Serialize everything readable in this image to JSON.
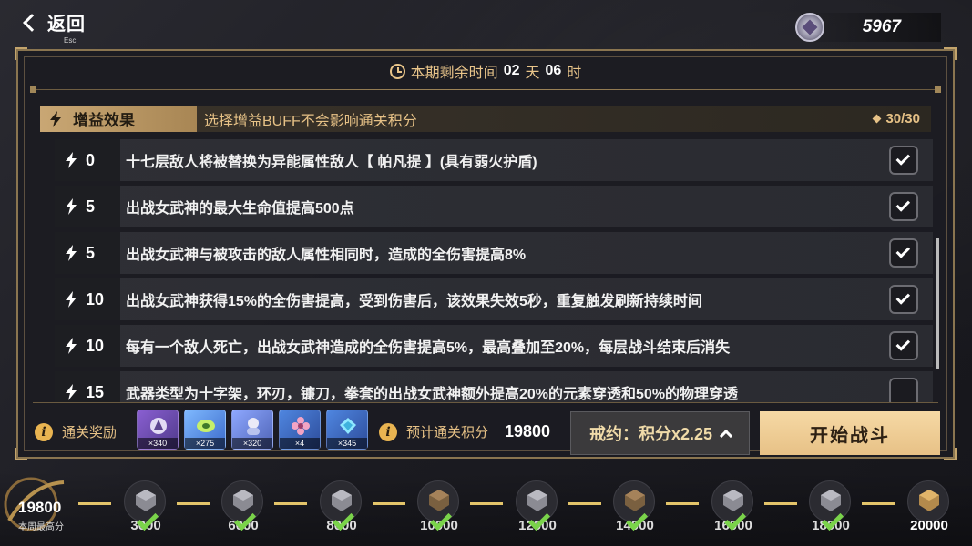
{
  "topbar": {
    "back_label": "返回",
    "esc_hint": "Esc",
    "currency_value": "5967"
  },
  "timer": {
    "prefix": "本期剩余时间",
    "days": "02",
    "days_unit": "天",
    "hours": "06",
    "hours_unit": "时"
  },
  "buff_header": {
    "tab_label": "增益效果",
    "note": "选择增益BUFF不会影响通关积分",
    "count": "30/30"
  },
  "buffs": [
    {
      "cost": "0",
      "text": "十七层敌人将被替换为异能属性敌人【 帕凡提 】(具有弱火护盾)",
      "checked": true
    },
    {
      "cost": "5",
      "text": "出战女武神的最大生命值提高500点",
      "checked": true
    },
    {
      "cost": "5",
      "text": "出战女武神与被攻击的敌人属性相同时，造成的全伤害提高8%",
      "checked": true
    },
    {
      "cost": "10",
      "text": "出战女武神获得15%的全伤害提高，受到伤害后，该效果失效5秒，重复触发刷新持续时间",
      "checked": true
    },
    {
      "cost": "10",
      "text": "每有一个敌人死亡，出战女武神造成的全伤害提高5%，最高叠加至20%，每层战斗结束后消失",
      "checked": true
    },
    {
      "cost": "15",
      "text": "武器类型为十字架，环刃，镰刀，拳套的出战女武神额外提高20%的元素穿透和50%的物理穿透",
      "checked": false
    }
  ],
  "rewards": {
    "label": "通关奖励",
    "items": [
      {
        "icon": "valkyrie-crest-icon",
        "qty": "×340"
      },
      {
        "icon": "green-disc-icon",
        "qty": "×275"
      },
      {
        "icon": "valkyrie-portrait-icon",
        "qty": "×320"
      },
      {
        "icon": "pink-flower-icon",
        "qty": "×4"
      },
      {
        "icon": "blue-crystal-icon",
        "qty": "×345"
      }
    ]
  },
  "predict": {
    "label": "预计通关积分",
    "value": "19800"
  },
  "pact_button": "戒约：积分x2.25",
  "start_button": "开始战斗",
  "progress": {
    "best_value": "19800",
    "best_label": "本周最高分",
    "nodes": [
      {
        "label": "3000",
        "claimed": true,
        "chest": "silver"
      },
      {
        "label": "6000",
        "claimed": true,
        "chest": "silver"
      },
      {
        "label": "8000",
        "claimed": true,
        "chest": "silver"
      },
      {
        "label": "10000",
        "claimed": true,
        "chest": "bronze"
      },
      {
        "label": "12000",
        "claimed": true,
        "chest": "silver"
      },
      {
        "label": "14000",
        "claimed": true,
        "chest": "bronze"
      },
      {
        "label": "16000",
        "claimed": true,
        "chest": "silver"
      },
      {
        "label": "18000",
        "claimed": true,
        "chest": "silver"
      },
      {
        "label": "20000",
        "claimed": false,
        "chest": "gold"
      }
    ]
  },
  "colors": {
    "gold_accent": "#e6c186",
    "start_button": "#e7c186",
    "track_line": "#e3c46a",
    "claimed_tick": "#7ad34a"
  }
}
